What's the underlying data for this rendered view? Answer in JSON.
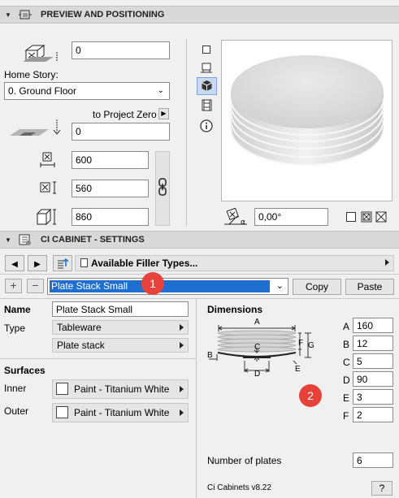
{
  "preview": {
    "title": "PREVIEW AND POSITIONING",
    "elevation_value": "0",
    "home_story_label": "Home Story:",
    "home_story_value": "0. Ground Floor",
    "project_zero_label": "to Project Zero",
    "project_zero_value": "0",
    "width_value": "600",
    "depth_value": "560",
    "height_value": "860",
    "angle_value": "0,00°"
  },
  "settings": {
    "title": "CI CABINET - SETTINGS",
    "filler_types_label": "Available Filler Types...",
    "selected_item": "Plate Stack Small",
    "copy_label": "Copy",
    "paste_label": "Paste",
    "name_label": "Name",
    "name_value": "Plate Stack Small",
    "type_label": "Type",
    "type_value": "Tableware",
    "subtype_value": "Plate stack",
    "surfaces_label": "Surfaces",
    "inner_label": "Inner",
    "inner_value": "Paint - Titanium White",
    "outer_label": "Outer",
    "outer_value": "Paint - Titanium White",
    "dimensions_label": "Dimensions",
    "diagram_labels": [
      "A",
      "B",
      "C",
      "D",
      "E",
      "F",
      "G"
    ],
    "dims": [
      {
        "key": "A",
        "value": "160"
      },
      {
        "key": "B",
        "value": "12"
      },
      {
        "key": "C",
        "value": "5"
      },
      {
        "key": "D",
        "value": "90"
      },
      {
        "key": "E",
        "value": "3"
      },
      {
        "key": "F",
        "value": "2"
      }
    ],
    "plates_label": "Number of plates",
    "plates_value": "6",
    "version": "Ci Cabinets v8.22",
    "help": "?"
  },
  "badges": [
    "1",
    "2"
  ],
  "colors": {
    "badge": "#e8413c",
    "selection": "#1f6fd1",
    "header": "#d9d9d9"
  }
}
